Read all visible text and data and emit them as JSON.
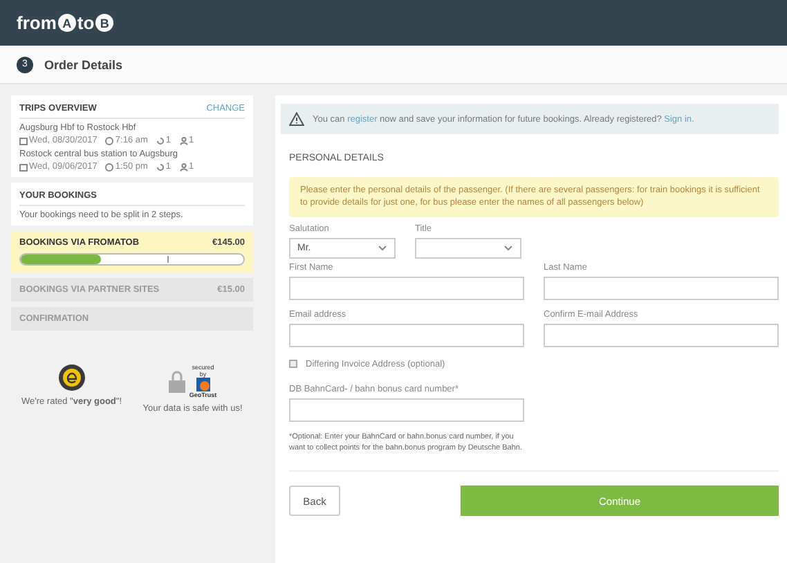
{
  "header": {
    "logo_parts": [
      "from",
      "A",
      "to",
      "B"
    ]
  },
  "step": {
    "number": "3",
    "title": "Order Details"
  },
  "sidebar": {
    "trips_overview": {
      "title": "TRIPS OVERVIEW",
      "action": "CHANGE",
      "trips": [
        {
          "route": "Augsburg Hbf to Rostock Hbf",
          "date": "Wed, 08/30/2017",
          "time": "7:16 am",
          "changes": "1",
          "passengers": "1"
        },
        {
          "route": "Rostock central bus station to Augsburg",
          "date": "Wed, 09/06/2017",
          "time": "1:50 pm",
          "changes": "1",
          "passengers": "1"
        }
      ]
    },
    "your_bookings": {
      "title": "YOUR BOOKINGS",
      "text": "Your bookings need to be split in 2 steps."
    },
    "steps": [
      {
        "title": "BOOKINGS VIA FROMATOB",
        "price": "€145.00",
        "selected": true,
        "level": 0.36
      },
      {
        "title": "BOOKINGS VIA PARTNER SITES",
        "price": "€15.00",
        "selected": false
      },
      {
        "title": "CONFIRMATION",
        "selected": false
      }
    ],
    "badges": [
      {
        "kind": "rating",
        "text": "We're rated \"**very good**\"!"
      },
      {
        "kind": "secure",
        "seal_top": "secured",
        "seal_mid": "by",
        "seal_name": "GeoTrust",
        "text": "Your data is safe with us!"
      }
    ]
  },
  "alert": {
    "before": "You can ",
    "link1": "register",
    "middle": " now and save your information for future bookings. Already registered? ",
    "link2": "Sign in."
  },
  "form": {
    "title": "PERSONAL DETAILS",
    "note": "Please enter the personal details of the passenger. (If there are several passengers: for train bookings it is sufficient to provide details for just one, for bus please enter the names of all passengers below)",
    "selects": [
      {
        "label": "Salutation",
        "value": "Mr."
      },
      {
        "label": "Title"
      }
    ],
    "rows": [
      [
        {
          "label": "First Name"
        },
        {
          "label": "Last Name"
        }
      ],
      [
        {
          "label": "Email address"
        },
        {
          "label": "Confirm E-mail Address"
        }
      ]
    ],
    "invoice": {
      "label": "Differing Invoice Address (optional)",
      "checked": false
    },
    "bahncard": {
      "label": "DB BahnCard- / bahn bonus card number*",
      "hint": "*Optional: Enter your BahnCard or bahn.bonus card number, if you want to collect points for the bahn.bonus program by Deutsche Bahn."
    },
    "buttons": {
      "back": "Back",
      "continue": "Continue"
    }
  }
}
